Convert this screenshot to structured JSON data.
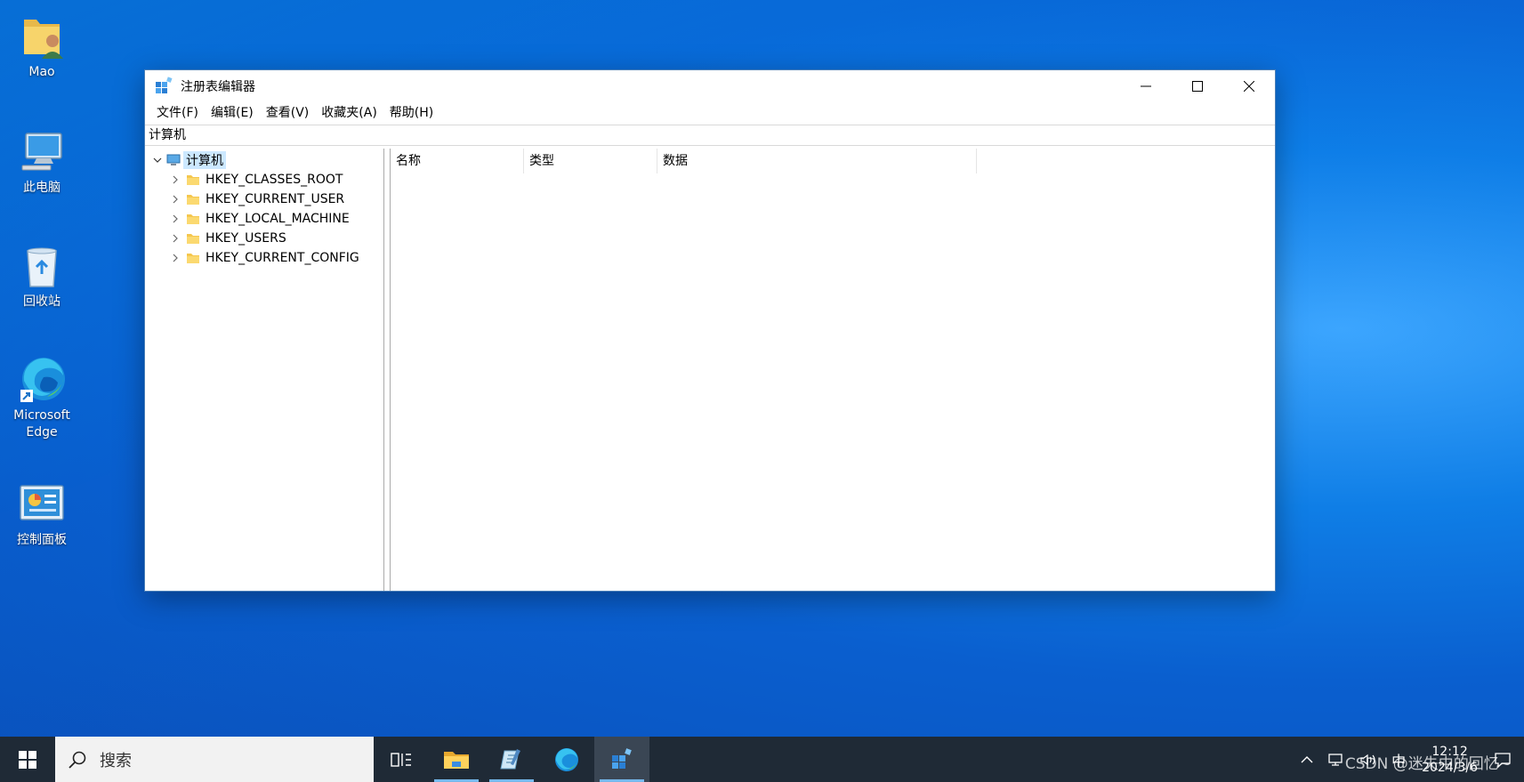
{
  "desktop": {
    "icons": [
      {
        "label": "Mao"
      },
      {
        "label": "此电脑"
      },
      {
        "label": "回收站"
      },
      {
        "label": "Microsoft Edge"
      },
      {
        "label": "控制面板"
      }
    ]
  },
  "window": {
    "title": "注册表编辑器",
    "menu": [
      "文件(F)",
      "编辑(E)",
      "查看(V)",
      "收藏夹(A)",
      "帮助(H)"
    ],
    "address": "计算机",
    "tree": {
      "root": "计算机",
      "children": [
        "HKEY_CLASSES_ROOT",
        "HKEY_CURRENT_USER",
        "HKEY_LOCAL_MACHINE",
        "HKEY_USERS",
        "HKEY_CURRENT_CONFIG"
      ]
    },
    "columns": [
      "名称",
      "类型",
      "数据"
    ]
  },
  "taskbar": {
    "search_placeholder": "搜索",
    "clock_time": "12:12",
    "clock_date": "2024/3/6",
    "ime_label": "中",
    "watermark": "CSDN @迷失中的回忆~"
  },
  "colors": {
    "taskbar_bg": "#1f2a36",
    "accent": "#76b9ed",
    "selection": "#cce8ff"
  }
}
